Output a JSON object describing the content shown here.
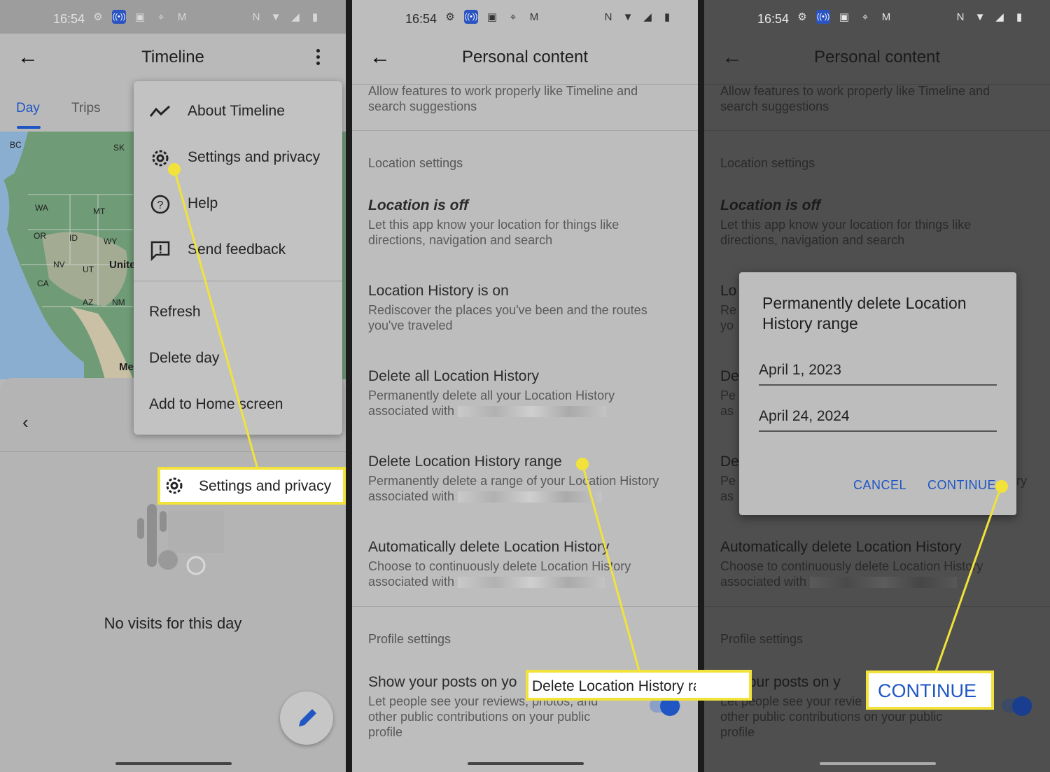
{
  "status_bar": {
    "time": "16:54"
  },
  "panel1": {
    "appbar": {
      "title": "Timeline"
    },
    "tabs": [
      {
        "label": "Day"
      },
      {
        "label": "Trips"
      }
    ],
    "map_labels": [
      "BC",
      "SK",
      "WA",
      "MT",
      "OR",
      "ID",
      "WY",
      "NV",
      "UT",
      "Unite",
      "CA",
      "AZ",
      "NM",
      "Me"
    ],
    "menu": {
      "items": [
        {
          "label": "About Timeline",
          "icon": "timeline-icon"
        },
        {
          "label": "Settings and privacy",
          "icon": "gear-icon"
        },
        {
          "label": "Help",
          "icon": "help-icon"
        },
        {
          "label": "Send feedback",
          "icon": "feedback-icon"
        }
      ],
      "plain_items": [
        {
          "label": "Refresh"
        },
        {
          "label": "Delete day"
        },
        {
          "label": "Add to Home screen"
        }
      ]
    },
    "empty_state": "No visits for this day",
    "callout": {
      "label": "Settings and privacy",
      "icon": "gear-icon"
    }
  },
  "panel2": {
    "appbar": {
      "title": "Personal content"
    },
    "intro": "Allow features to work properly like Timeline and search suggestions",
    "section_location": "Location settings",
    "items": [
      {
        "title": "Location is off",
        "subtitle": "Let this app know your location for things like directions, navigation and search"
      },
      {
        "title": "Location History is on",
        "subtitle": "Rediscover the places you've been and the routes you've traveled"
      },
      {
        "title": "Delete all Location History",
        "subtitle_a": "Permanently delete all your Location History",
        "subtitle_b": "associated with"
      },
      {
        "title": "Delete Location History range",
        "subtitle_a": "Permanently delete a range of your Location History",
        "subtitle_b": "associated with"
      },
      {
        "title": "Automatically delete Location History",
        "subtitle_a": "Choose to continuously delete Location History",
        "subtitle_b": "associated with"
      }
    ],
    "section_profile": "Profile settings",
    "profile_item": {
      "title": "Show your posts on yo",
      "subtitle": "Let people see your reviews, photos, and other public contributions on your public profile"
    },
    "callout": {
      "label": "Delete Location History range"
    }
  },
  "panel3": {
    "appbar": {
      "title": "Personal content"
    },
    "intro": "Allow features to work properly like Timeline and search suggestions",
    "section_location": "Location settings",
    "location_off_title": "Location is off",
    "location_off_sub": "Let this app know your location for things like directions, navigation and search",
    "partial_a": "Lo",
    "partial_a_sub1": "Re",
    "partial_a_sub2": "yo",
    "partial_b": "De",
    "partial_b_sub1": "Pe",
    "partial_b_sub2": "as",
    "partial_c": "De",
    "partial_c_sub1": "Pe",
    "partial_c_sub2": "as",
    "partial_c_right": "ry",
    "auto_title": "Automatically delete Location History",
    "auto_sub_a": "Choose to continuously delete Location History",
    "auto_sub_b": "associated with",
    "section_profile": "Profile settings",
    "profile_title": "y your posts on y",
    "profile_sub1": "Let people see your revie",
    "profile_sub2": "other public contributions on your public",
    "profile_sub3": "profile",
    "dialog": {
      "title": "Permanently delete Location History range",
      "start_date": "April 1, 2023",
      "end_date": "April 24, 2024",
      "cancel": "CANCEL",
      "continue": "CONTINUE"
    },
    "callout": {
      "label": "CONTINUE"
    }
  },
  "colors": {
    "accent": "#1f56c4",
    "callout": "#f2e23a"
  }
}
